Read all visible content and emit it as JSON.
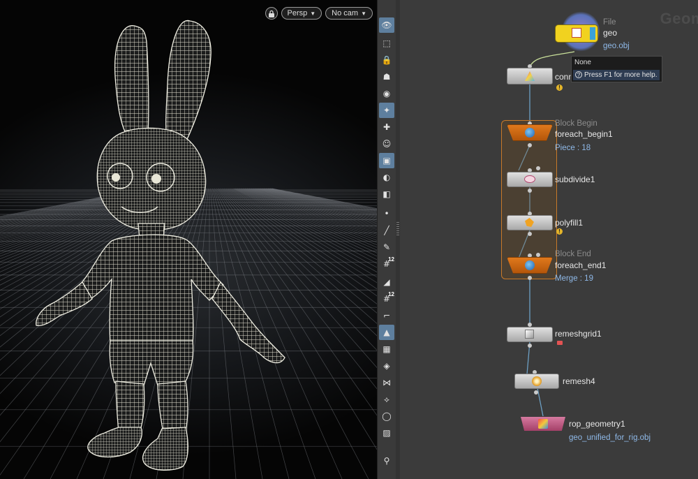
{
  "viewport": {
    "camera_mode": "Persp",
    "camera_select": "No cam",
    "icons": [
      "lock-icon",
      "caret-down-icon"
    ]
  },
  "side_toolbar": {
    "tools": [
      "view-icon",
      "selection-icon",
      "lock-icon",
      "ghost-icon",
      "display-icon",
      "light-icon",
      "add-light-icon",
      "add-object-icon",
      "camera-icon",
      "visibility-icon",
      "snapshot-icon",
      "point-icon",
      "line-icon",
      "brush-icon",
      "point-number-icon",
      "plane-icon",
      "prim-number-icon",
      "corner-icon",
      "shading-icon",
      "texture-icon",
      "flat-shade-icon",
      "bone-icon",
      "hierarchy-icon",
      "circle-icon",
      "image-icon",
      "pin-icon"
    ],
    "point_number_badge_1": "12",
    "point_number_badge_2": "12",
    "active_tools": [
      "view-icon",
      "light-icon",
      "camera-icon",
      "shading-icon"
    ]
  },
  "network": {
    "title": "Geom",
    "tooltip": {
      "line1": "None",
      "line2": "Press F1 for more help."
    },
    "nodes": [
      {
        "id": "file",
        "type_label": "File",
        "name": "geo",
        "sub": "geo.obj"
      },
      {
        "id": "connect",
        "name": "conn",
        "has_warning": true
      },
      {
        "id": "foreach_begin1",
        "type_label": "Block Begin",
        "name": "foreach_begin1",
        "sub": "Piece : 18"
      },
      {
        "id": "subdivide1",
        "name": "subdivide1"
      },
      {
        "id": "polyfill1",
        "name": "polyfill1",
        "has_warning": true
      },
      {
        "id": "foreach_end1",
        "type_label": "Block End",
        "name": "foreach_end1",
        "sub": "Merge : 19"
      },
      {
        "id": "remeshgrid1",
        "name": "remeshgrid1",
        "has_lock": true
      },
      {
        "id": "remesh4",
        "name": "remesh4"
      },
      {
        "id": "rop_geometry1",
        "name": "rop_geometry1",
        "sub": "geo_unified_for_rig.obj"
      }
    ]
  },
  "colors": {
    "viewport_bg": "#15171a",
    "network_bg": "#3b3b3b",
    "wire": "#6c9fc4",
    "block_orange": "#d06f19",
    "selected_yellow": "#f1d21f",
    "sub_text_blue": "#8fb9e8",
    "rop_pink": "#c15c86"
  }
}
